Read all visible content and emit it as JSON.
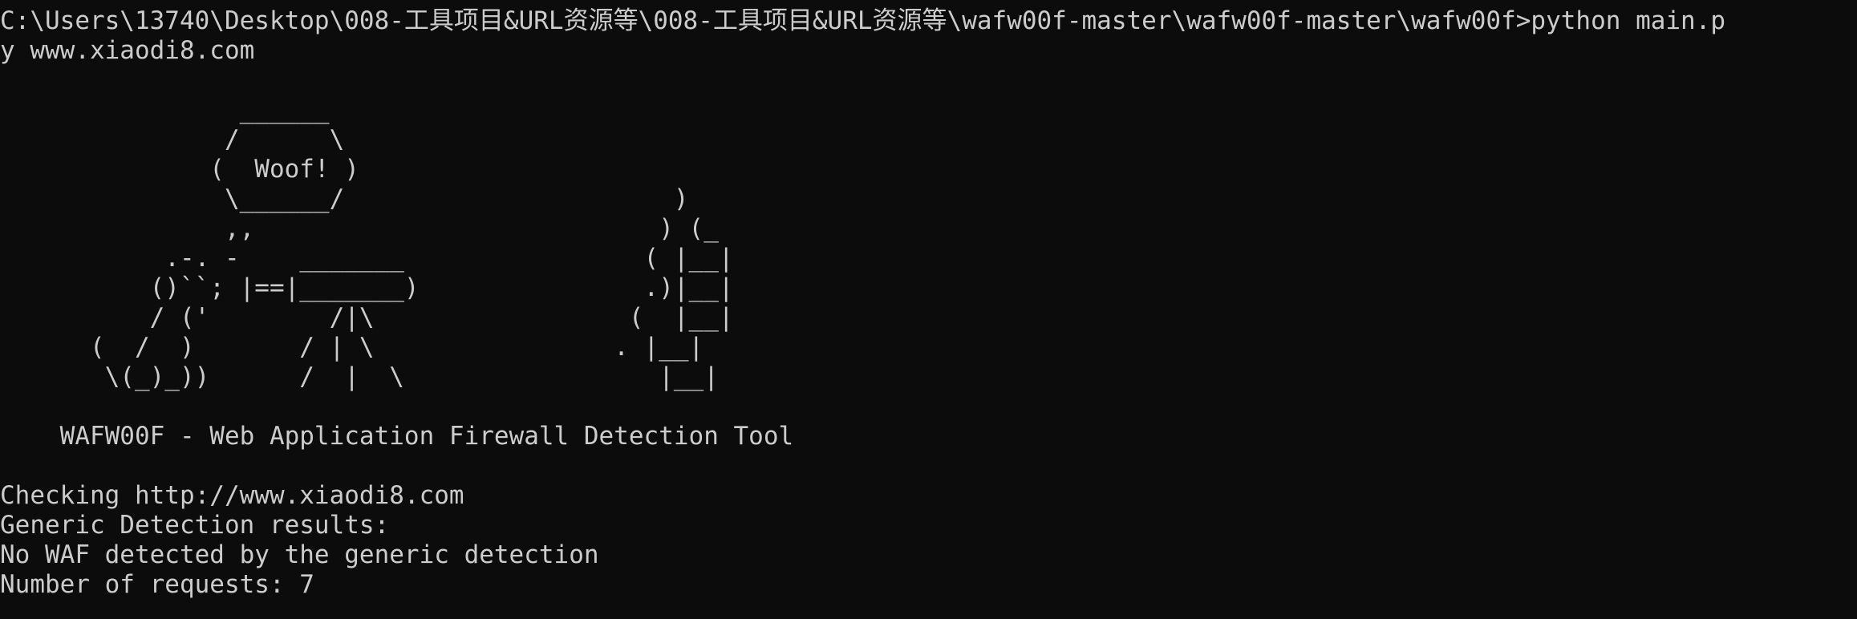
{
  "terminal": {
    "background": "#0c0c0c",
    "foreground": "#cccccc",
    "lines": [
      "C:\\Users\\13740\\Desktop\\008-工具项目&URL资源等\\008-工具项目&URL资源等\\wafw00f-master\\wafw00f-master\\wafw00f>python main.p",
      "y www.xiaodi8.com",
      "",
      "                ______",
      "               /      \\",
      "              (  Woof! )",
      "               \\______/                      )",
      "               ,,                           ) (_",
      "           .-. -    _______                ( |__|",
      "          ()``; |==|_______)               .)|__|",
      "          / ('        /|\\                 (  |__|",
      "      (  /  )       / | \\                . |__|",
      "       \\(_)_))      /  |  \\                 |__|",
      "",
      "    WAFW00F - Web Application Firewall Detection Tool",
      "",
      "Checking http://www.xiaodi8.com",
      "Generic Detection results:",
      "No WAF detected by the generic detection",
      "Number of requests: 7"
    ]
  }
}
